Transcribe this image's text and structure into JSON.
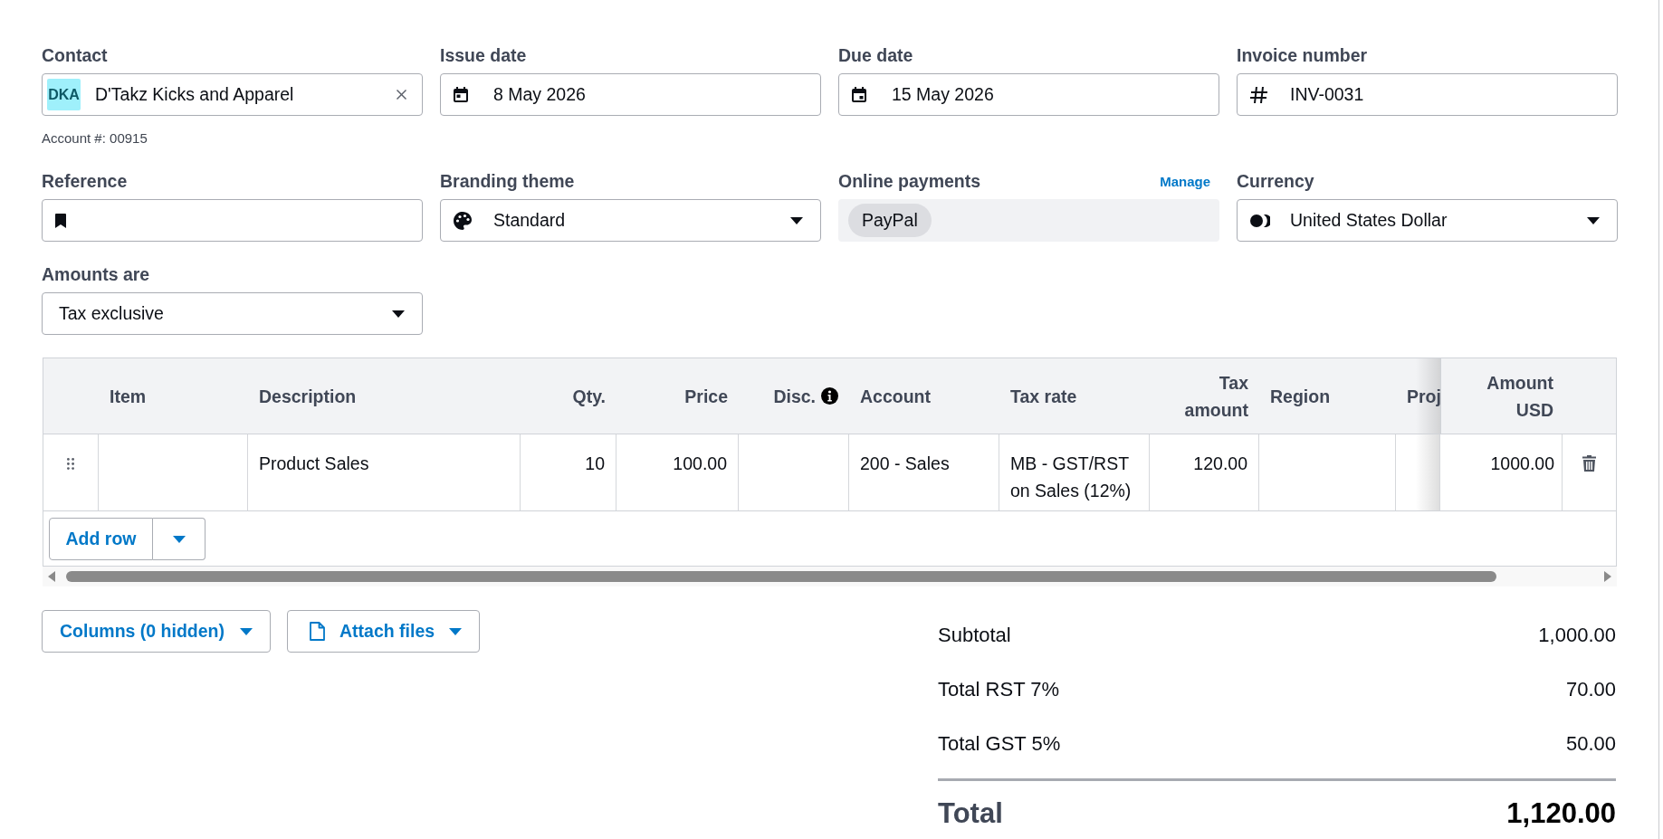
{
  "contact": {
    "label": "Contact",
    "initials": "DKA",
    "value": "D'Takz Kicks and Apparel",
    "account": "Account #: 00915"
  },
  "issue_date": {
    "label": "Issue date",
    "value": "8 May 2026"
  },
  "due_date": {
    "label": "Due date",
    "value": "15 May 2026"
  },
  "invoice_number": {
    "label": "Invoice number",
    "value": "INV-0031"
  },
  "reference": {
    "label": "Reference"
  },
  "branding_theme": {
    "label": "Branding theme",
    "value": "Standard"
  },
  "online_payments": {
    "label": "Online payments",
    "action": "Manage",
    "methods": [
      "PayPal"
    ]
  },
  "currency": {
    "label": "Currency",
    "value": "United States Dollar"
  },
  "amounts_are": {
    "label": "Amounts are",
    "value": "Tax exclusive"
  },
  "line_items": {
    "columns": [
      {
        "label": "Item",
        "kind": "text",
        "info": false
      },
      {
        "label": "Description",
        "kind": "text",
        "info": false
      },
      {
        "label": "Qty.",
        "kind": "number",
        "info": false
      },
      {
        "label": "Price",
        "kind": "number",
        "info": false
      },
      {
        "label": "Disc.",
        "kind": "number",
        "info": true
      },
      {
        "label": "Account",
        "kind": "text",
        "info": false
      },
      {
        "label": "Tax rate",
        "kind": "text",
        "info": false
      },
      {
        "label": "Tax amount",
        "kind": "number",
        "info": false
      },
      {
        "label": "Region",
        "kind": "text",
        "info": false
      },
      {
        "label": "Proj",
        "kind": "text",
        "info": false
      },
      {
        "label": "Amount USD",
        "kind": "number",
        "info": false
      }
    ],
    "rows": [
      {
        "cells": [
          null,
          "Product Sales",
          "10",
          "100.00",
          null,
          "200 - Sales",
          "MB - GST/RST on Sales (12%)",
          "120.00",
          null,
          null,
          "1000.00"
        ]
      }
    ],
    "add_row": "Add row"
  },
  "footer_buttons": [
    {
      "kind": "columns",
      "label": "Columns (0 hidden)"
    },
    {
      "kind": "attach",
      "label": "Attach files"
    }
  ],
  "totals": {
    "lines": [
      {
        "label": "Subtotal",
        "value": "1,000.00"
      },
      {
        "label": "Total RST 7%",
        "value": "70.00"
      },
      {
        "label": "Total GST 5%",
        "value": "50.00"
      }
    ],
    "total": {
      "label": "Total",
      "value": "1,120.00"
    }
  }
}
